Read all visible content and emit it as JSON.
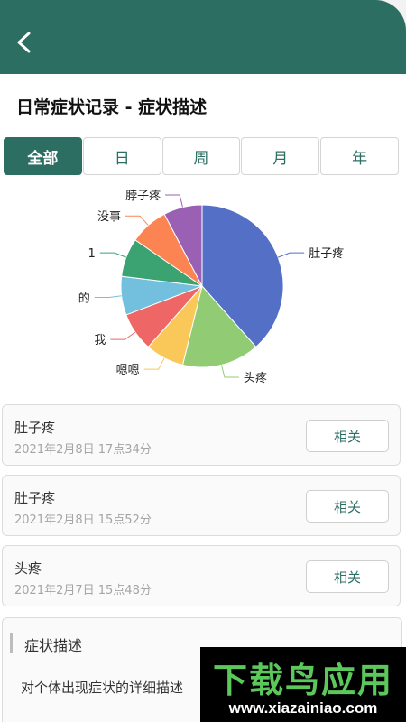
{
  "header": {
    "back_icon": "chevron-left-icon"
  },
  "page": {
    "title": "日常症状记录 - 症状描述"
  },
  "tabs": [
    {
      "label": "全部",
      "active": true
    },
    {
      "label": "日",
      "active": false
    },
    {
      "label": "周",
      "active": false
    },
    {
      "label": "月",
      "active": false
    },
    {
      "label": "年",
      "active": false
    }
  ],
  "chart_data": {
    "type": "pie",
    "title": "",
    "slices": [
      {
        "label": "肚子疼",
        "value": 10,
        "color": "#5470c6"
      },
      {
        "label": "头疼",
        "value": 4,
        "color": "#91cc75"
      },
      {
        "label": "嗯嗯",
        "value": 2,
        "color": "#fac858"
      },
      {
        "label": "我",
        "value": 2,
        "color": "#ee6666"
      },
      {
        "label": "的",
        "value": 2,
        "color": "#73c0de"
      },
      {
        "label": "1",
        "value": 2,
        "color": "#3ba272"
      },
      {
        "label": "没事",
        "value": 2,
        "color": "#fc8452"
      },
      {
        "label": "脖子疼",
        "value": 2,
        "color": "#9a60b4"
      }
    ]
  },
  "records": [
    {
      "title": "肚子疼",
      "time": "2021年2月8日 17点34分",
      "button": "相关"
    },
    {
      "title": "肚子疼",
      "time": "2021年2月8日 15点52分",
      "button": "相关"
    },
    {
      "title": "头疼",
      "time": "2021年2月7日 15点48分",
      "button": "相关"
    }
  ],
  "description": {
    "title": "症状描述",
    "text": "对个体出现症状的详细描述"
  },
  "watermark": {
    "brand": "下载鸟应用",
    "url": "www.xiazainiao.com"
  }
}
